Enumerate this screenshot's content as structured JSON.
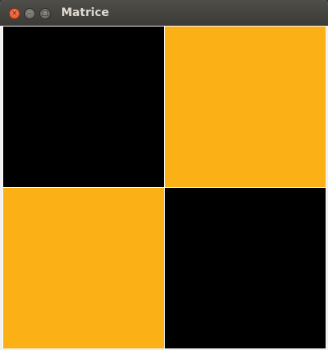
{
  "window": {
    "title": "Matrice"
  },
  "titlebar_buttons": {
    "close_glyph": "×",
    "minimize_glyph": "–",
    "maximize_glyph": "□"
  },
  "colors": {
    "black": "#000000",
    "orange": "#fbb015",
    "separator": "#ffffff"
  },
  "matrix": {
    "rows": 2,
    "cols": 2,
    "cells": [
      [
        "black",
        "orange"
      ],
      [
        "orange",
        "black"
      ]
    ]
  }
}
